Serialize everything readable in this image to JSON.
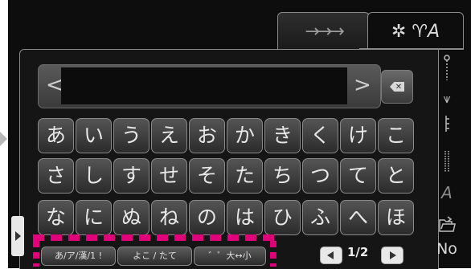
{
  "tabs": {
    "decor": {
      "label": "→→→"
    },
    "alpha": {
      "label": "✲ ♈A"
    }
  },
  "text_field": {
    "value": "",
    "left_arrow": "<",
    "right_arrow": ">"
  },
  "keyboard": {
    "rows": [
      [
        "あ",
        "い",
        "う",
        "え",
        "お",
        "か",
        "き",
        "く",
        "け",
        "こ"
      ],
      [
        "さ",
        "し",
        "す",
        "せ",
        "そ",
        "た",
        "ち",
        "つ",
        "て",
        "と"
      ],
      [
        "な",
        "に",
        "ぬ",
        "ね",
        "の",
        "は",
        "ひ",
        "ふ",
        "へ",
        "ほ"
      ]
    ]
  },
  "modes": {
    "charset_label": "あ/ア/漢/1 !",
    "orientation_label": "よこ / たて",
    "modifier_label": "゛゜大↔小"
  },
  "paging": {
    "indicator": "1/2"
  },
  "side_icons": [
    "needle-thread-icon",
    "stitch-icon",
    "straight-stitch-icon",
    "dotted-stitch-icon",
    "italic-a-icon",
    "folder-open-icon",
    "no-icon"
  ],
  "side_texts": {
    "a": "A",
    "no": "No"
  },
  "colors": {
    "highlight_dash": "#e0007a",
    "background": "#0d0d0d",
    "key_border": "#8a8a8a"
  }
}
